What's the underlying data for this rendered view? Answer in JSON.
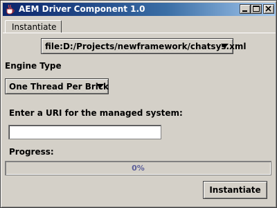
{
  "window": {
    "title": "AEM Driver Component 1.0",
    "icon": "java-cup-icon",
    "controls": {
      "minimize": "minimize-icon",
      "maximize": "maximize-icon",
      "close": "close-icon"
    }
  },
  "tabs": [
    {
      "label": "Instantiate",
      "selected": true
    }
  ],
  "form": {
    "file_selected": "file:D:/Projects/newframework/chatsys.xml",
    "engine_label": "Engine Type",
    "engine_selected": "One Thread Per Brick",
    "uri_label": "Enter a URI for the managed system:",
    "uri_value": "",
    "progress_label": "Progress:",
    "progress_text": "0%",
    "progress_fraction": 0,
    "submit_label": "Instantiate"
  },
  "colors": {
    "titlebar_start": "#0a246a",
    "titlebar_end": "#a6caf0",
    "face": "#d4d0c8",
    "progress_text": "#5c5f99"
  }
}
